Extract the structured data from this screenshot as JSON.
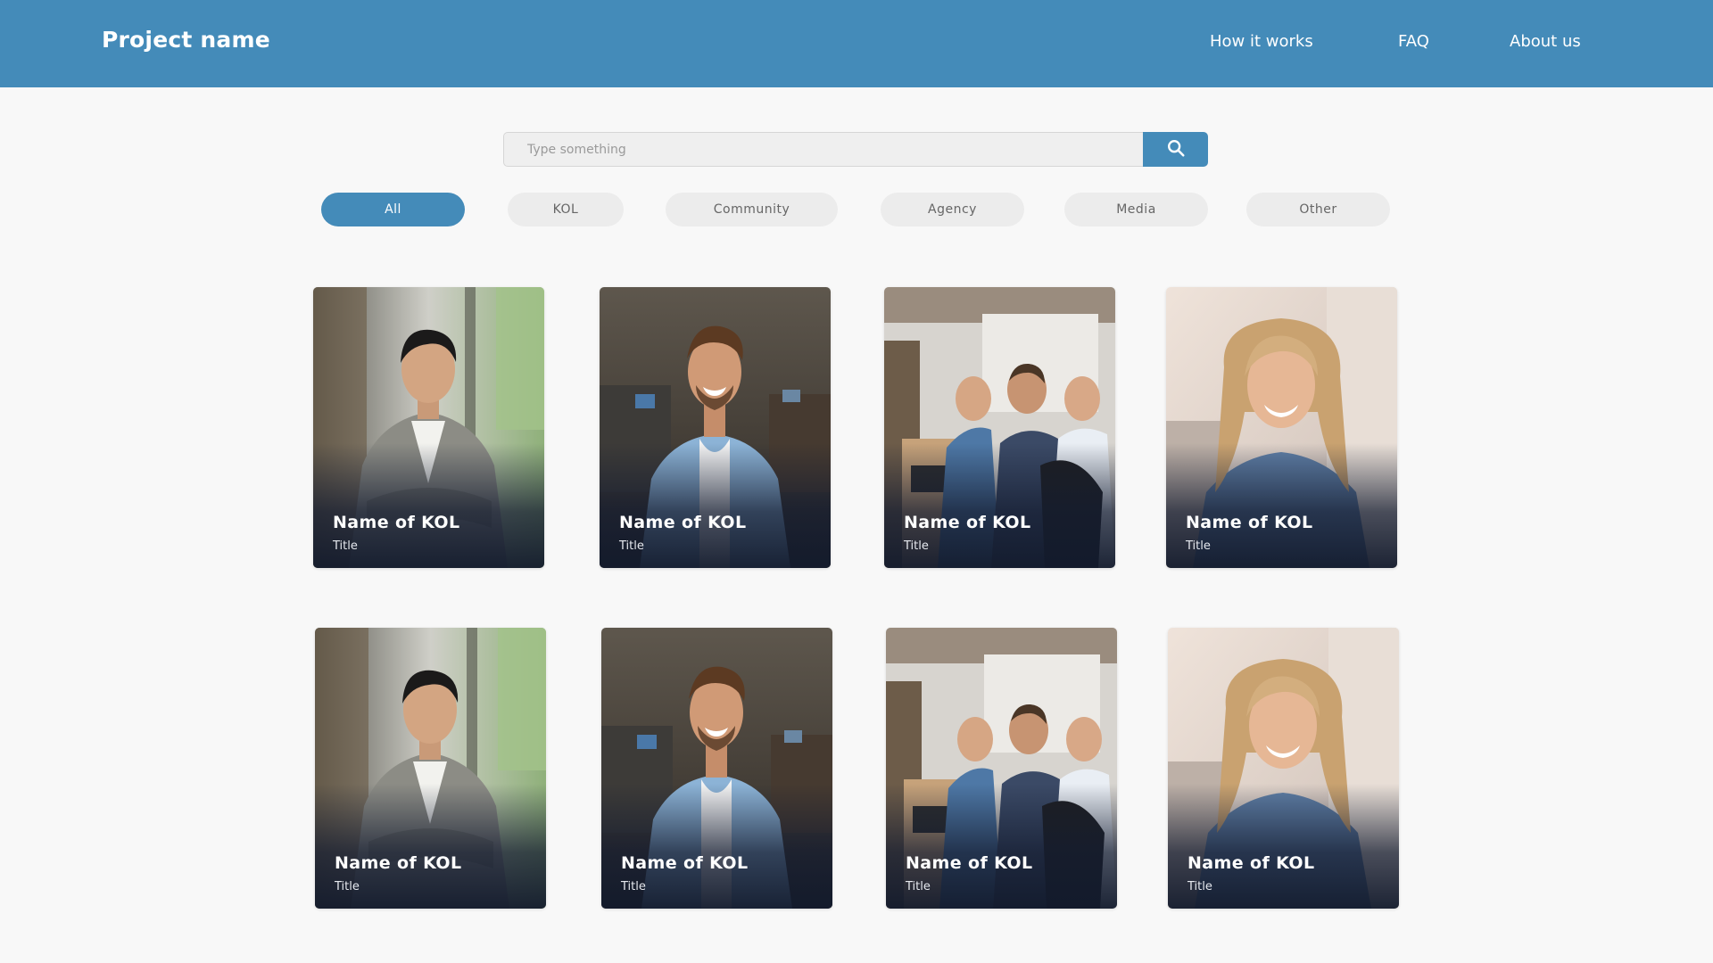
{
  "header": {
    "brand": "Project name",
    "nav": [
      "How it works",
      "FAQ",
      "About us"
    ]
  },
  "search": {
    "placeholder": "Type something",
    "icon": "search-icon"
  },
  "filters": [
    {
      "label": "All",
      "active": true
    },
    {
      "label": "KOL",
      "active": false
    },
    {
      "label": "Community",
      "active": false
    },
    {
      "label": "Agency",
      "active": false
    },
    {
      "label": "Media",
      "active": false
    },
    {
      "label": "Other",
      "active": false
    }
  ],
  "cards": [
    {
      "name": "Name of KOL",
      "title": "Title",
      "photo": "man-in-suit"
    },
    {
      "name": "Name of KOL",
      "title": "Title",
      "photo": "man-in-denim-office"
    },
    {
      "name": "Name of KOL",
      "title": "Title",
      "photo": "team-meeting"
    },
    {
      "name": "Name of KOL",
      "title": "Title",
      "photo": "woman-in-denim"
    },
    {
      "name": "Name of KOL",
      "title": "Title",
      "photo": "man-in-suit"
    },
    {
      "name": "Name of KOL",
      "title": "Title",
      "photo": "man-in-denim-office"
    },
    {
      "name": "Name of KOL",
      "title": "Title",
      "photo": "team-meeting"
    },
    {
      "name": "Name of KOL",
      "title": "Title",
      "photo": "woman-in-denim"
    }
  ],
  "colors": {
    "primary": "#448bb9",
    "background": "#f8f8f8",
    "pill": "#ececec"
  }
}
